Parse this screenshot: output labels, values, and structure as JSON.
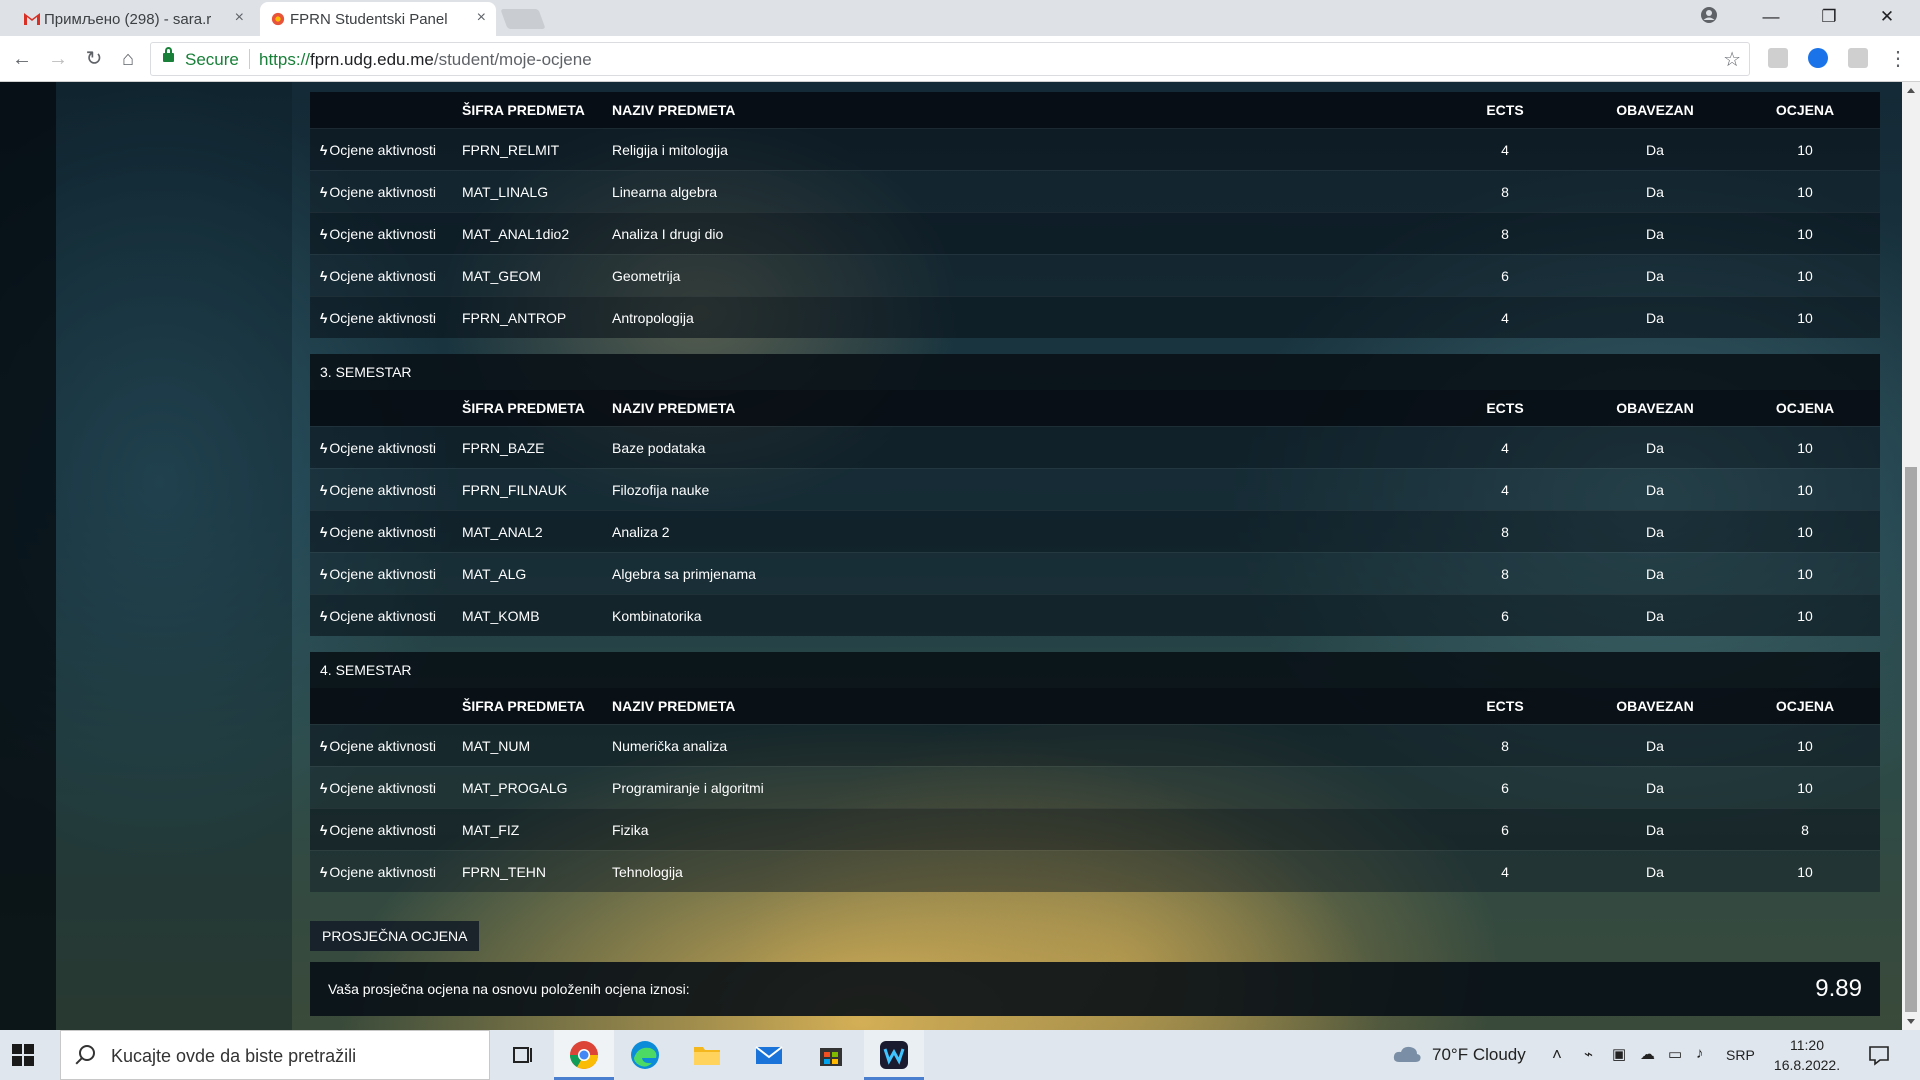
{
  "browser": {
    "tabs": [
      {
        "title": "Примљено (298) - sara.r",
        "favicon": "gmail-icon"
      },
      {
        "title": "FPRN Studentski Panel",
        "favicon": "site-icon"
      }
    ],
    "address": {
      "secure_label": "Secure",
      "scheme": "https://",
      "domain": "fprn.udg.edu.me",
      "path": "/student/moje-ocjene"
    }
  },
  "columns": {
    "code": "ŠIFRA PREDMETA",
    "name": "NAZIV PREDMETA",
    "ects": "ECTS",
    "mandatory": "OBAVEZAN",
    "grade": "OCJENA"
  },
  "activity_label": "Ocjene aktivnosti",
  "semesters": [
    {
      "title": "",
      "rows": [
        {
          "code": "FPRN_RELMIT",
          "name": "Religija i mitologija",
          "ects": "4",
          "mandatory": "Da",
          "grade": "10"
        },
        {
          "code": "MAT_LINALG",
          "name": "Linearna algebra",
          "ects": "8",
          "mandatory": "Da",
          "grade": "10"
        },
        {
          "code": "MAT_ANAL1dio2",
          "name": "Analiza I drugi dio",
          "ects": "8",
          "mandatory": "Da",
          "grade": "10"
        },
        {
          "code": "MAT_GEOM",
          "name": "Geometrija",
          "ects": "6",
          "mandatory": "Da",
          "grade": "10"
        },
        {
          "code": "FPRN_ANTROP",
          "name": "Antropologija",
          "ects": "4",
          "mandatory": "Da",
          "grade": "10"
        }
      ]
    },
    {
      "title": "3. SEMESTAR",
      "rows": [
        {
          "code": "FPRN_BAZE",
          "name": "Baze podataka",
          "ects": "4",
          "mandatory": "Da",
          "grade": "10"
        },
        {
          "code": "FPRN_FILNAUK",
          "name": "Filozofija nauke",
          "ects": "4",
          "mandatory": "Da",
          "grade": "10"
        },
        {
          "code": "MAT_ANAL2",
          "name": "Analiza 2",
          "ects": "8",
          "mandatory": "Da",
          "grade": "10"
        },
        {
          "code": "MAT_ALG",
          "name": "Algebra sa primjenama",
          "ects": "8",
          "mandatory": "Da",
          "grade": "10"
        },
        {
          "code": "MAT_KOMB",
          "name": "Kombinatorika",
          "ects": "6",
          "mandatory": "Da",
          "grade": "10"
        }
      ]
    },
    {
      "title": "4. SEMESTAR",
      "rows": [
        {
          "code": "MAT_NUM",
          "name": "Numerička analiza",
          "ects": "8",
          "mandatory": "Da",
          "grade": "10"
        },
        {
          "code": "MAT_PROGALG",
          "name": "Programiranje i algoritmi",
          "ects": "6",
          "mandatory": "Da",
          "grade": "10"
        },
        {
          "code": "MAT_FIZ",
          "name": "Fizika",
          "ects": "6",
          "mandatory": "Da",
          "grade": "8"
        },
        {
          "code": "FPRN_TEHN",
          "name": "Tehnologija",
          "ects": "4",
          "mandatory": "Da",
          "grade": "10"
        }
      ]
    }
  ],
  "average": {
    "label": "PROSJEČNA OCJENA",
    "text": "Vaša prosječna ocjena na osnovu položenih ocjena iznosi:",
    "value": "9.89"
  },
  "taskbar": {
    "search_placeholder": "Kucajte ovde da biste pretražili",
    "weather": "70°F  Cloudy",
    "language": "SRP",
    "time": "11:20",
    "date": "16.8.2022."
  }
}
